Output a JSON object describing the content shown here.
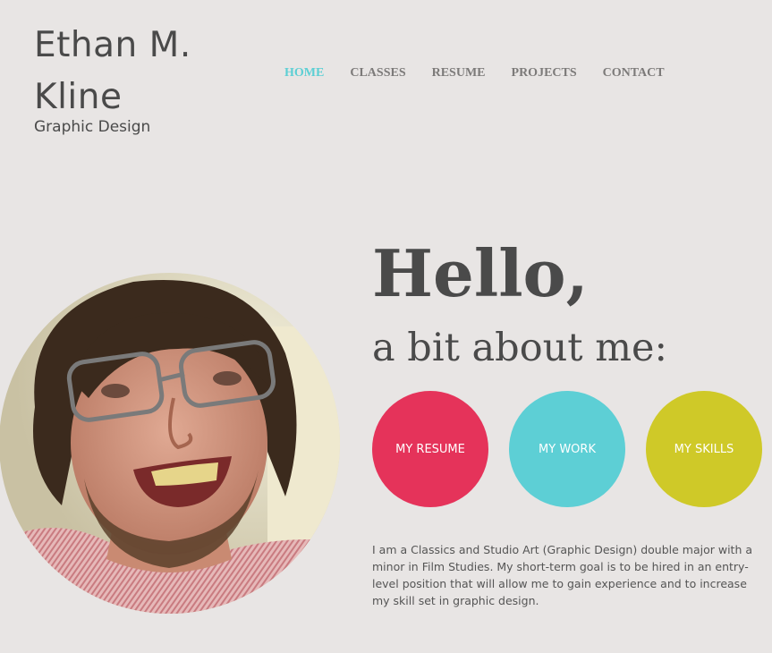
{
  "header": {
    "name": "Ethan M. Kline",
    "subtitle": "Graphic Design"
  },
  "nav": {
    "items": [
      {
        "label": "HOME",
        "active": true
      },
      {
        "label": "CLASSES",
        "active": false
      },
      {
        "label": "RESUME",
        "active": false
      },
      {
        "label": "PROJECTS",
        "active": false
      },
      {
        "label": "CONTACT",
        "active": false
      }
    ]
  },
  "hero": {
    "title": "Hello,",
    "subtitle": "a bit about me:"
  },
  "buttons": [
    {
      "label": "MY RESUME",
      "color": "#e5335a"
    },
    {
      "label": "MY WORK",
      "color": "#5dcfd5"
    },
    {
      "label": "MY SKILLS",
      "color": "#cfc928"
    }
  ],
  "bio": "I am a Classics and Studio Art (Graphic Design) double major with a minor in Film Studies.  My short-term goal is to be hired in an entry-level position that will allow me to gain experience and  to increase my skill set in graphic design.",
  "colors": {
    "background": "#e8e5e4",
    "text": "#4a4a4a",
    "nav_active": "#5ccfd4",
    "nav_inactive": "#7c7a79"
  }
}
